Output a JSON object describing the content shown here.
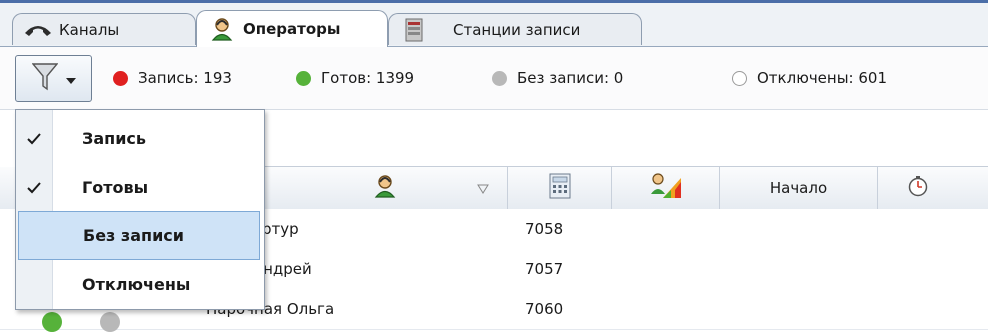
{
  "tabs": [
    {
      "label": "Каналы",
      "icon": "phone-icon"
    },
    {
      "label": "Операторы",
      "icon": "operator-icon"
    },
    {
      "label": "Станции записи",
      "icon": "server-icon"
    }
  ],
  "toolbar": {
    "stats": [
      {
        "label": "Запись: 193",
        "color": "#e02020"
      },
      {
        "label": "Готов: 1399",
        "color": "#56b23a"
      },
      {
        "label": "Без записи: 0",
        "color": "#b8b8b8"
      },
      {
        "label": "Отключены: 601",
        "color": "#ffffff"
      }
    ]
  },
  "filter_menu": {
    "items": [
      {
        "label": "Запись",
        "checked": true
      },
      {
        "label": "Готовы",
        "checked": true
      },
      {
        "label": "Без записи",
        "checked": false
      },
      {
        "label": "Отключены",
        "checked": false
      }
    ]
  },
  "grid": {
    "headers": {
      "start": "Начало"
    },
    "rows": [
      {
        "name": "…зов Артур",
        "ext": "7058"
      },
      {
        "name": "…ков Андрей",
        "ext": "7057"
      },
      {
        "name": "Парочная Ольга",
        "ext": "7060"
      }
    ]
  }
}
